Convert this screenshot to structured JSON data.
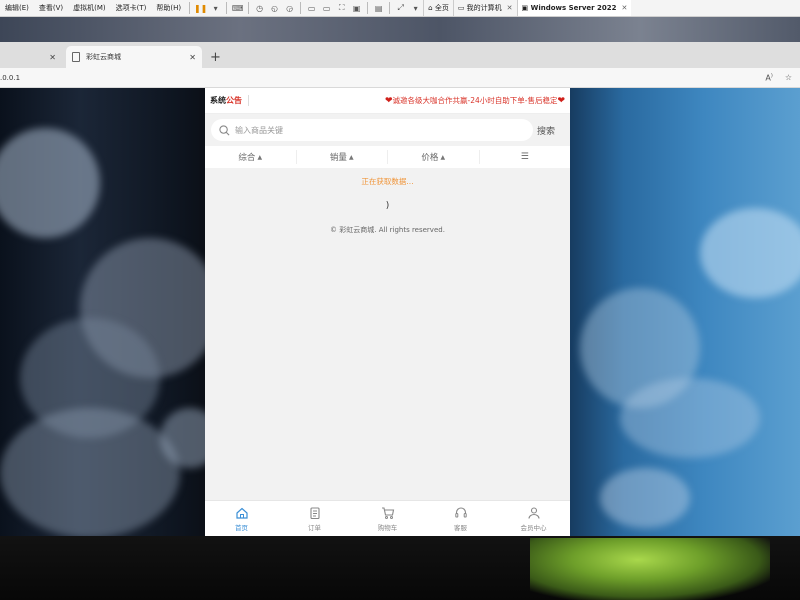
{
  "vm_toolbar": {
    "menus": [
      "编辑(E)",
      "查看(V)",
      "虚拟机(M)",
      "选项卡(T)",
      "帮助(H)"
    ],
    "tabs": [
      {
        "label": "全页",
        "icon": "home-icon",
        "active": false
      },
      {
        "label": "我的计算机",
        "icon": "monitor-icon",
        "active": false
      },
      {
        "label": "Windows Server 2022",
        "icon": "vm-icon",
        "active": true
      }
    ]
  },
  "browser": {
    "tabs": [
      {
        "label": ""
      },
      {
        "label": "彩虹云商城"
      }
    ],
    "address": ".0.0.1"
  },
  "shop": {
    "notice": {
      "title_a": "系统",
      "title_b": "公告",
      "text": "诚邀各级大咖合作共赢-24小时自助下单-售后稳定"
    },
    "search": {
      "placeholder": "输入商品关键",
      "button": "搜索"
    },
    "sort": [
      "综合",
      "销量",
      "价格"
    ],
    "loading": "正在获取数据...",
    "paren": ")",
    "copyright": "© 彩虹云商城. All rights reserved.",
    "nav": [
      {
        "label": "首页",
        "icon": "home-icon",
        "active": true
      },
      {
        "label": "订单",
        "icon": "order-icon",
        "active": false
      },
      {
        "label": "购物车",
        "icon": "cart-icon",
        "active": false
      },
      {
        "label": "客服",
        "icon": "headset-icon",
        "active": false
      },
      {
        "label": "会员中心",
        "icon": "user-icon",
        "active": false
      }
    ]
  },
  "colors": {
    "accent": "#3b8fd6",
    "notice_red": "#d9342a",
    "loading_orange": "#f0963c"
  }
}
